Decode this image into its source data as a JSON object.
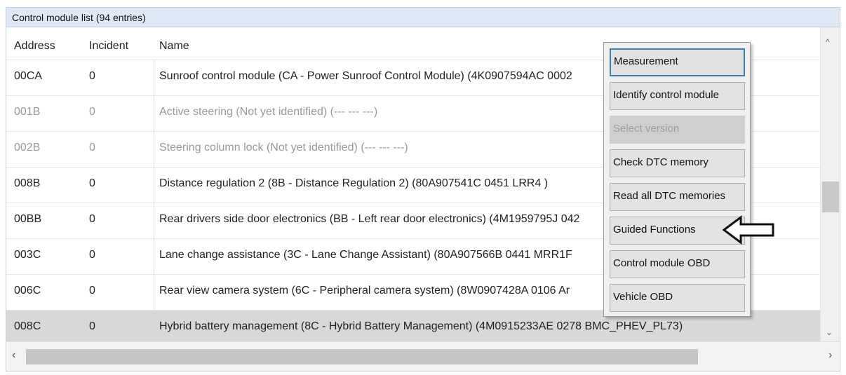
{
  "window_title": "Control module list (94 entries)",
  "columns": {
    "address": "Address",
    "incident": "Incident",
    "name": "Name"
  },
  "rows": [
    {
      "address": "00CA",
      "incident": "0",
      "name": "Sunroof control module (CA - Power Sunroof Control Module) (4K0907594AC  0002",
      "state": "normal"
    },
    {
      "address": "001B",
      "incident": "0",
      "name": "Active steering (Not yet identified) (---   ---   ---)",
      "state": "dim"
    },
    {
      "address": "002B",
      "incident": "0",
      "name": "Steering column lock (Not yet identified) (---   ---   ---)",
      "state": "dim"
    },
    {
      "address": "008B",
      "incident": "0",
      "name": "Distance regulation 2 (8B - Distance Regulation 2) (80A907541C   0451   LRR4          )",
      "state": "normal"
    },
    {
      "address": "00BB",
      "incident": "0",
      "name": "Rear drivers side door electronics (BB - Left rear door electronics) (4M1959795J   042",
      "state": "normal"
    },
    {
      "address": "003C",
      "incident": "0",
      "name": "Lane change assistance (3C - Lane Change Assistant) (80A907566B   0441   MRR1F",
      "state": "normal"
    },
    {
      "address": "006C",
      "incident": "0",
      "name": "Rear view camera system (6C - Peripheral camera system) (8W0907428A   0106   Ar",
      "state": "normal"
    },
    {
      "address": "008C",
      "incident": "0",
      "name": "Hybrid battery management (8C - Hybrid Battery Management) (4M0915233AE   0278   BMC_PHEV_PL73)",
      "state": "selected"
    }
  ],
  "context_menu": [
    {
      "label": "Measurement",
      "state": "focused"
    },
    {
      "label": "Identify control module",
      "state": "normal"
    },
    {
      "label": "Select version",
      "state": "disabled"
    },
    {
      "label": "Check DTC memory",
      "state": "normal"
    },
    {
      "label": "Read all DTC memories",
      "state": "normal"
    },
    {
      "label": "Guided Functions",
      "state": "normal"
    },
    {
      "label": "Control module OBD",
      "state": "normal"
    },
    {
      "label": "Vehicle OBD",
      "state": "normal"
    }
  ],
  "annotation": {
    "icon": "arrow-left-outline-icon",
    "points_to": "Guided Functions"
  }
}
